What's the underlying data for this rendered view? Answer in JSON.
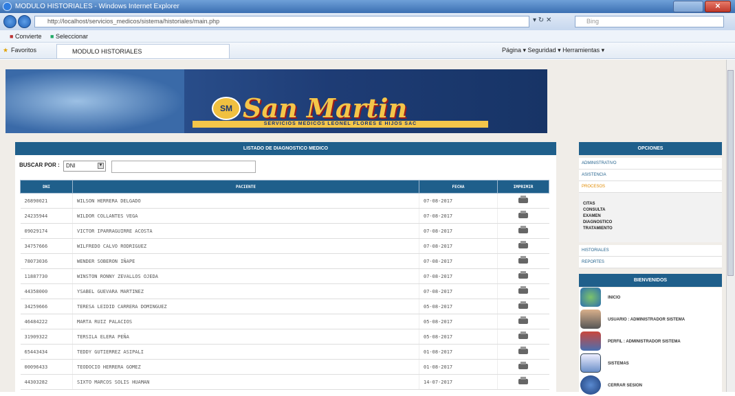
{
  "browser": {
    "window_title": "MODULO HISTORIALES - Windows Internet Explorer",
    "address": "http://localhost/servicios_medicos/sistema/historiales/main.php",
    "search_placeholder": "Bing",
    "favbar_items": [
      "Convierte",
      "Seleccionar"
    ],
    "favorites_label": "Favoritos",
    "tab_title": "MODULO HISTORIALES",
    "commandbar": "Página ▾   Seguridad ▾   Herramientas ▾"
  },
  "banner": {
    "brand": "San Martin",
    "subtitle": "SERVICIOS MEDICOS LEONEL FLORES E HIJOS SAC",
    "badge": "SM"
  },
  "main": {
    "title": "LISTADO DE DIAGNOSTICO MEDICO",
    "search_label": "BUSCAR POR :",
    "search_selected": "DNI",
    "columns": [
      "DNI",
      "PACIENTE",
      "FECHA",
      "IMPRIMIR"
    ],
    "rows": [
      {
        "dni": "26890021",
        "paciente": "WILSON HERRERA DELGADO",
        "fecha": "07-08-2017"
      },
      {
        "dni": "24235944",
        "paciente": "WILDOR COLLANTES VEGA",
        "fecha": "07-08-2017"
      },
      {
        "dni": "09029174",
        "paciente": "VICTOR IPARRAGUIRRE ACOSTA",
        "fecha": "07-08-2017"
      },
      {
        "dni": "34757666",
        "paciente": "WILFREDO CALVO RODRIGUEZ",
        "fecha": "07-08-2017"
      },
      {
        "dni": "78073036",
        "paciente": "WENDER SOBERON IÑAPE",
        "fecha": "07-08-2017"
      },
      {
        "dni": "11887730",
        "paciente": "WINSTON RONNY ZEVALLOS OJEDA",
        "fecha": "07-08-2017"
      },
      {
        "dni": "44358000",
        "paciente": "YSABEL GUEVARA MARTINEZ",
        "fecha": "07-08-2017"
      },
      {
        "dni": "34259666",
        "paciente": "TERESA LEIDID CARRERA DOMINGUEZ",
        "fecha": "05-08-2017"
      },
      {
        "dni": "46484222",
        "paciente": "MARTA RUIZ PALACIOS",
        "fecha": "05-08-2017"
      },
      {
        "dni": "31909322",
        "paciente": "TERSILA ELERA PEÑA",
        "fecha": "05-08-2017"
      },
      {
        "dni": "65443434",
        "paciente": "TEDDY GUTIERREZ ASIPALI",
        "fecha": "01-08-2017"
      },
      {
        "dni": "00096433",
        "paciente": "TEODOCIO HERRERA GOMEZ",
        "fecha": "01-08-2017"
      },
      {
        "dni": "44303282",
        "paciente": "SIXTO MARCOS SOLIS HUAMAN",
        "fecha": "14-07-2017"
      }
    ]
  },
  "side": {
    "options_title": "OPCIONES",
    "items": [
      "ADMINISTRATIVO",
      "ASISTENCIA",
      "PROCESOS",
      "HISTORIALES",
      "REPORTES"
    ],
    "submenu": [
      "CITAS",
      "CONSULTA",
      "EXAMEN",
      "DIAGNOSTICO",
      "TRATAMIENTO"
    ],
    "welcome_title": "BIENVENIDOS",
    "welcome_items": [
      "INICIO",
      "USUARIO : ADMINISTRADOR SISTEMA",
      "PERFIL : ADMINISTRADOR SISTEMA",
      "SISTEMAS",
      "CERRAR SESION"
    ]
  },
  "colors": {
    "header_blue": "#1f5f8b",
    "active_orange": "#e08a00",
    "logo_gold": "#f4c64a"
  }
}
